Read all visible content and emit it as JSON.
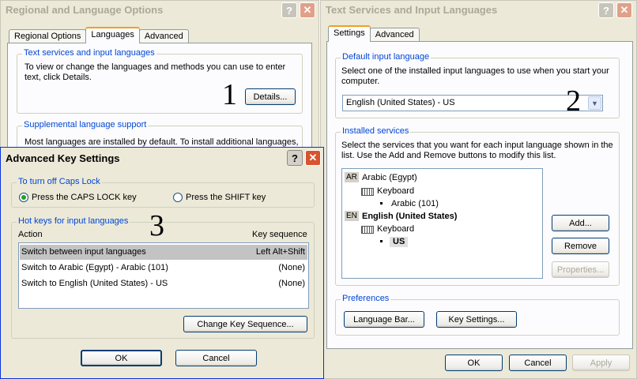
{
  "regional_window": {
    "title": "Regional and Language Options",
    "help_label": "?",
    "close_label": "✕",
    "tabs": [
      "Regional Options",
      "Languages",
      "Advanced"
    ],
    "text_services_group": {
      "title": "Text services and input languages",
      "description": "To view or change the languages and methods you can use to enter text, click Details.",
      "details_button": "Details..."
    },
    "supplemental_group": {
      "title": "Supplemental language support",
      "description": "Most languages are installed by default. To install additional languages,"
    },
    "annotation": "1"
  },
  "text_services_window": {
    "title": "Text Services and Input Languages",
    "help_label": "?",
    "close_label": "✕",
    "tabs": [
      "Settings",
      "Advanced"
    ],
    "default_input": {
      "title": "Default input language",
      "description": "Select one of the installed input languages to use when you start your computer.",
      "selected_value": "English (United States) - US"
    },
    "installed_services": {
      "title": "Installed services",
      "description": "Select the services that you want for each input language shown in the list. Use the Add and Remove buttons to modify this list.",
      "languages": [
        {
          "code": "AR",
          "name": "Arabic (Egypt)",
          "category": "Keyboard",
          "layout": "Arabic (101)"
        },
        {
          "code": "EN",
          "name": "English (United States)",
          "category": "Keyboard",
          "layout": "US"
        }
      ],
      "add_button": "Add...",
      "remove_button": "Remove",
      "properties_button": "Properties..."
    },
    "preferences": {
      "title": "Preferences",
      "language_bar_button": "Language Bar...",
      "key_settings_button": "Key Settings..."
    },
    "ok_button": "OK",
    "cancel_button": "Cancel",
    "apply_button": "Apply",
    "annotation": "2"
  },
  "advanced_key_window": {
    "title": "Advanced Key Settings",
    "help_label": "?",
    "close_label": "✕",
    "caps_lock_group": {
      "title": "To turn off Caps Lock",
      "options": [
        "Press the CAPS LOCK key",
        "Press the SHIFT key"
      ],
      "selected_index": 0
    },
    "hotkeys_group": {
      "title": "Hot keys for input languages",
      "columns": [
        "Action",
        "Key sequence"
      ],
      "rows": [
        {
          "action": "Switch between input languages",
          "sequence": "Left Alt+Shift"
        },
        {
          "action": "Switch to Arabic (Egypt) - Arabic (101)",
          "sequence": "(None)"
        },
        {
          "action": "Switch to English (United States) - US",
          "sequence": "(None)"
        }
      ],
      "change_button": "Change Key Sequence..."
    },
    "ok_button": "OK",
    "cancel_button": "Cancel",
    "annotation": "3"
  }
}
